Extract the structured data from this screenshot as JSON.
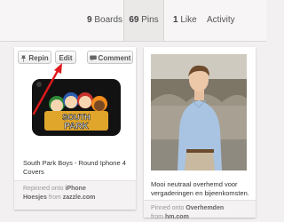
{
  "profile_tabs": {
    "boards_count": "9",
    "boards_label": "Boards",
    "pins_count": "69",
    "pins_label": "Pins",
    "likes_count": "1",
    "likes_label": "Like",
    "activity_label": "Activity"
  },
  "pin_left": {
    "repin_label": "Repin",
    "edit_label": "Edit",
    "comment_label": "Comment",
    "description": "South Park Boys - Round Iphone 4 Covers",
    "repinned_prefix": "Repinned onto",
    "board_name_1": "iPhone",
    "board_name_2": "Hoesjes",
    "from_word": "from",
    "source": "zazzle.com",
    "logo_word_1": "SOUTH",
    "logo_word_2": "PARK"
  },
  "pin_right": {
    "description": "Mooi neutraal overhemd voor vergaderingen en bijeenkomsten.",
    "pinned_prefix": "Pinned onto",
    "board_name": "Overhemden",
    "from_word": "from",
    "source": "hm.com"
  },
  "colors": {
    "background": "#f2f0f0",
    "annotation_arrow": "#e0191c",
    "link_text": "#666666"
  },
  "icons": [
    "pin-icon",
    "comment-bubble-icon"
  ]
}
